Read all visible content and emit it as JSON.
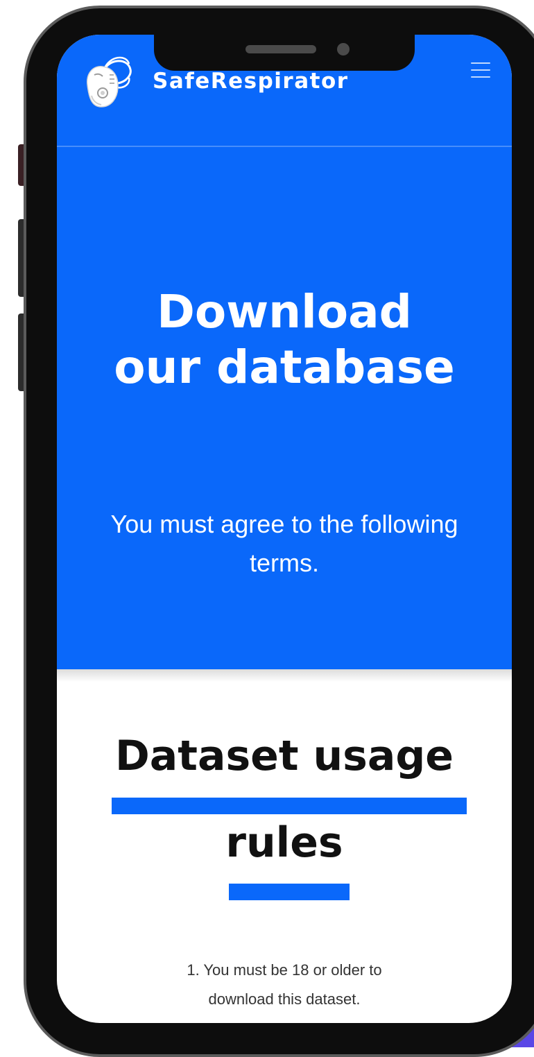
{
  "header": {
    "brand_name": "SafeRespirator",
    "logo_icon": "respirator-mask-icon",
    "menu_icon": "hamburger-menu-icon"
  },
  "hero": {
    "title_line1": "Download",
    "title_line2": "our database",
    "subtitle": "You must agree to the following terms."
  },
  "rules": {
    "heading_line1": "Dataset usage",
    "heading_line2": "rules",
    "items": [
      {
        "line1": "1. You must be 18 or older to",
        "line2": "download this dataset."
      }
    ]
  },
  "colors": {
    "brand_blue": "#0a68fa",
    "phone_frame": "#0d0d0d",
    "bezel_rim": "#5b5b5b",
    "background_accent": "#5a47e6"
  }
}
